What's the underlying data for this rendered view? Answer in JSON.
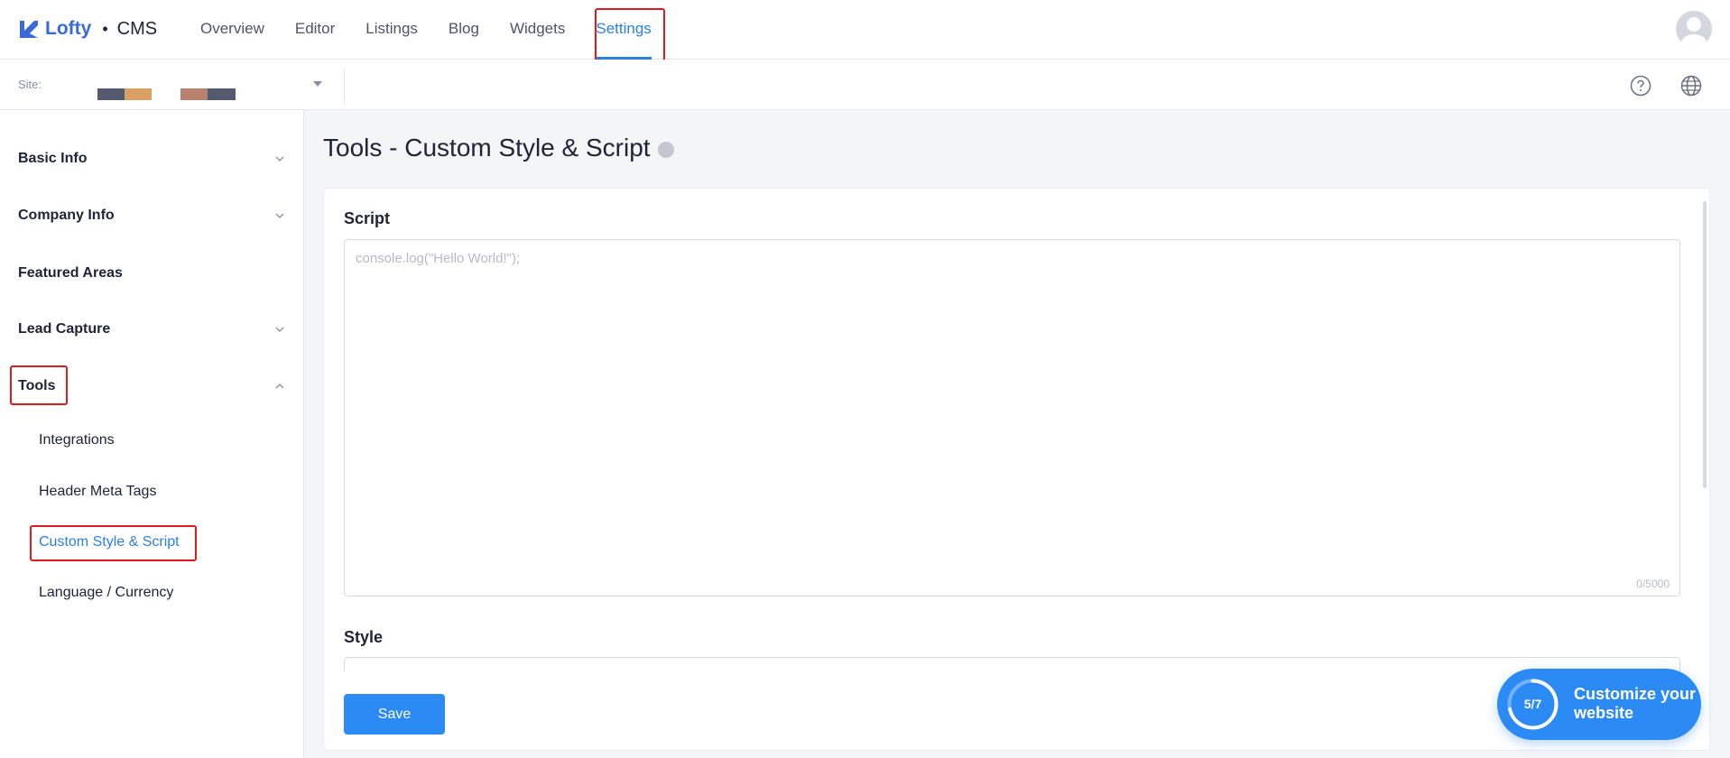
{
  "brand": {
    "name": "Lofty",
    "separator": "•",
    "product": "CMS"
  },
  "nav": {
    "tabs": [
      {
        "label": "Overview"
      },
      {
        "label": "Editor"
      },
      {
        "label": "Listings"
      },
      {
        "label": "Blog"
      },
      {
        "label": "Widgets"
      },
      {
        "label": "Settings",
        "active": true
      }
    ]
  },
  "subbar": {
    "site_label": "Site:"
  },
  "sidebar": {
    "items": [
      {
        "label": "Basic Info",
        "expandable": true
      },
      {
        "label": "Company Info",
        "expandable": true
      },
      {
        "label": "Featured Areas",
        "expandable": false
      },
      {
        "label": "Lead Capture",
        "expandable": true
      },
      {
        "label": "Tools",
        "expandable": true,
        "expanded": true
      }
    ],
    "tools_sub": [
      {
        "label": "Integrations"
      },
      {
        "label": "Header Meta Tags"
      },
      {
        "label": "Custom Style & Script",
        "active": true
      },
      {
        "label": "Language / Currency"
      }
    ]
  },
  "main": {
    "title": "Tools - Custom Style & Script",
    "script": {
      "label": "Script",
      "placeholder": "console.log(\"Hello World!\");",
      "counter": "0/5000"
    },
    "style": {
      "label": "Style"
    },
    "save_label": "Save"
  },
  "widget": {
    "progress": "5/7",
    "progress_fraction": 0.714,
    "label": "Customize your website"
  },
  "colors": {
    "accent": "#2b8af4",
    "brand": "#3a6ad6",
    "highlight": "#e01a1a"
  }
}
